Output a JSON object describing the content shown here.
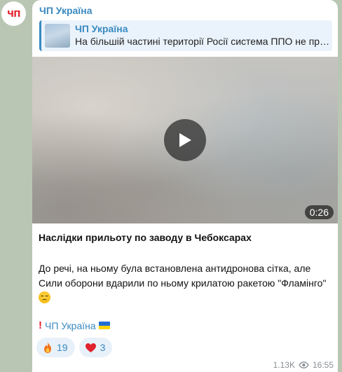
{
  "channel": {
    "avatar_text": "ЧП",
    "name": "ЧП Україна"
  },
  "reply": {
    "title": "ЧП Україна",
    "text": "На більшій частині території Росії система ППО не пра..."
  },
  "video": {
    "duration": "0:26"
  },
  "post": {
    "title": "Наслідки прильоту по заводу в Чебоксарах",
    "body_line1": "До речі, на ньому була встановлена антидронова сітка, але",
    "body_line2": "Сили оборони вдарили по ньому крилатою ракетою \"Фламінго\"",
    "signature": "ЧП Україна"
  },
  "reactions": [
    {
      "icon": "fire-icon",
      "count": "19"
    },
    {
      "icon": "heart-icon",
      "count": "3"
    }
  ],
  "meta": {
    "views": "1.13K",
    "time": "16:55"
  },
  "colors": {
    "accent": "#3a8ac0",
    "brand_red": "#e11d2a",
    "bubble": "#ffffff",
    "background": "#b9c6b3"
  }
}
